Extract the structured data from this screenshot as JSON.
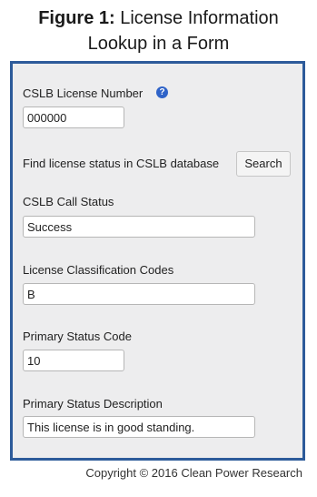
{
  "caption": {
    "figure_label": "Figure 1:",
    "title_line1": "License Information",
    "title_line2": "Lookup in a Form"
  },
  "form": {
    "license_number": {
      "label": "CSLB License Number",
      "value": "000000"
    },
    "find_status": {
      "text": "Find license status in CSLB database",
      "button_label": "Search"
    },
    "call_status": {
      "label": "CSLB Call Status",
      "value": "Success"
    },
    "classification": {
      "label": "License Classification Codes",
      "value": "B"
    },
    "primary_code": {
      "label": "Primary Status Code",
      "value": "10"
    },
    "primary_description": {
      "label": "Primary Status Description",
      "value": "This license is in good standing."
    }
  },
  "footer": {
    "copyright": "Copyright © 2016 Clean Power Research"
  },
  "colors": {
    "frame_border": "#2d5b9a",
    "panel_bg": "#ededee",
    "help_icon": "#2f63c8"
  },
  "icons": {
    "help": "question-circle-icon"
  }
}
